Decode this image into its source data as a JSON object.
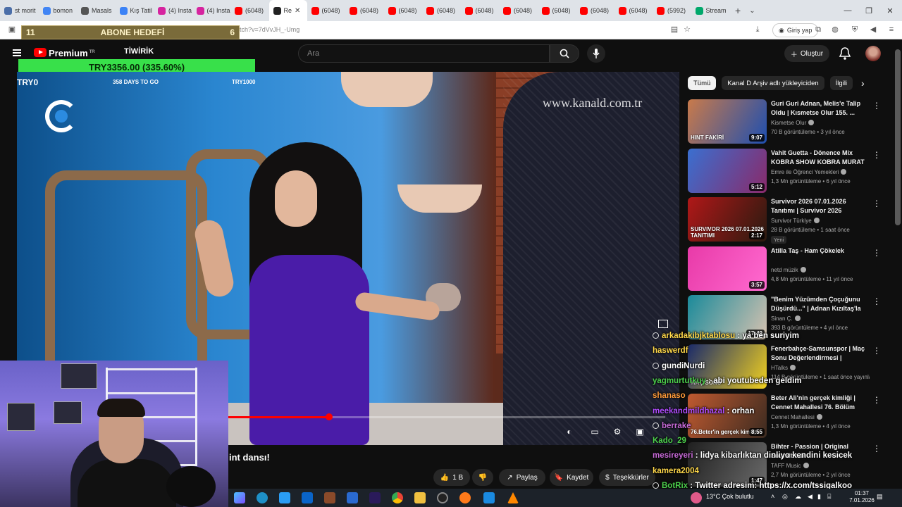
{
  "browser": {
    "tabs": [
      {
        "label": "st morit",
        "color": "#4b6ea8"
      },
      {
        "label": "bomon",
        "color": "#4285f4"
      },
      {
        "label": "Masals",
        "color": "#555555"
      },
      {
        "label": "Kış Tatil",
        "color": "#3b82f6"
      },
      {
        "label": "(4) Insta",
        "color": "#d6249f"
      },
      {
        "label": "(4) Insta",
        "color": "#d6249f"
      },
      {
        "label": "(6048)",
        "color": "#ff0000"
      },
      {
        "label": "Re",
        "color": "#222222",
        "active": true
      },
      {
        "label": "(6048)",
        "color": "#ff0000"
      },
      {
        "label": "(6048)",
        "color": "#ff0000"
      },
      {
        "label": "(6048)",
        "color": "#ff0000"
      },
      {
        "label": "(6048)",
        "color": "#ff0000"
      },
      {
        "label": "(6048)",
        "color": "#ff0000"
      },
      {
        "label": "(6048)",
        "color": "#ff0000"
      },
      {
        "label": "(6048)",
        "color": "#ff0000"
      },
      {
        "label": "(6048)",
        "color": "#ff0000"
      },
      {
        "label": "(6048)",
        "color": "#ff0000"
      },
      {
        "label": "(5992)",
        "color": "#ff0000"
      },
      {
        "label": "Stream",
        "color": "#00a86b"
      }
    ],
    "url_fragment": "tch?v=7dVvJH_-Umg",
    "login_label": "Giriş yap"
  },
  "overlay": {
    "goal_count": "11",
    "goal_label": "ABONE HEDEFİ",
    "goal_target": "6",
    "streamer_name": "TİWİRİK",
    "crypto_value": "TRY3356.00 (335.60%)",
    "try0": "TRY0",
    "days_left": "358 DAYS TO GO",
    "try1000": "TRY1000"
  },
  "youtube": {
    "brand": "Premium",
    "brand_region": "TR",
    "search_placeholder": "Ara",
    "create_label": "Oluştur",
    "video_watermark": "www.kanald.com.tr",
    "video_title": "int dansı!",
    "video_progress": 0.23,
    "actions": {
      "like_count": "1 B",
      "share": "Paylaş",
      "save": "Kaydet",
      "thanks": "Teşekkürler"
    },
    "chips": [
      {
        "label": "Tümü",
        "active": true
      },
      {
        "label": "Kanal D Arşiv adlı yükleyiciden",
        "active": false
      },
      {
        "label": "İlgili",
        "active": false
      }
    ],
    "recommendations": [
      {
        "title": "Guri Guri Adnan, Melis'e Talip Oldu | Kısmetse Olur 155. ...",
        "channel": "Kismetse Olur",
        "meta": "70 B görüntüleme • 3 yıl önce",
        "duration": "9:07",
        "thumb_text": "HINT FAKİRİ",
        "badge": "",
        "c1": "#c97a4a",
        "c2": "#1e4fb0"
      },
      {
        "title": "Vahit Guetta - Dönence Mix KOBRA SHOW KOBRA MURAT",
        "channel": "Emre ile Öğrenci Yemekleri",
        "meta": "1,3 Mn görüntüleme • 6 yıl önce",
        "duration": "5:12",
        "thumb_text": "",
        "badge": "",
        "c1": "#3a6fd0",
        "c2": "#8a2a6a"
      },
      {
        "title": "Survivor 2026 07.01.2026 Tanıtımı | Survivor 2026 Ünlüle...",
        "channel": "Survivor Türkiye",
        "meta": "28 B görüntüleme • 1 saat önce",
        "duration": "2:17",
        "thumb_text": "SURVIVOR 2026 07.01.2026 TANITIMI",
        "badge": "Yeni",
        "c1": "#b01818",
        "c2": "#2a1a10"
      },
      {
        "title": "Atilla Taş - Ham Çökelek",
        "channel": "netd müzik",
        "meta": "4,8 Mn görüntüleme • 11 yıl önce",
        "duration": "3:57",
        "thumb_text": "",
        "badge": "",
        "c1": "#e83aa8",
        "c2": "#ff6ad0"
      },
      {
        "title": "\"Benim Yüzümden Çoçuğunu Düşürdü...\" | Adnan Kızıltaş'la ...",
        "channel": "Sinan Ç.",
        "meta": "393 B görüntüleme • 4 yıl önce",
        "duration": "17:49",
        "thumb_text": "",
        "badge": "",
        "c1": "#1a8a9a",
        "c2": "#d6c2b0"
      },
      {
        "title": "Fenerbahçe-Samsunspor | Maç Sonu Değerlendirmesi | Uwufufu",
        "channel": "HTalks",
        "meta": "114 B görüntüleme • 1 saat önce yayınla...",
        "duration": "",
        "thumb_text": "MAÇ SONU",
        "badge": "",
        "c1": "#1a2a6a",
        "c2": "#f0d020"
      },
      {
        "title": "Beter Ali'nin gerçek kimliği | Cennet Mahallesi 76. Bölüm",
        "channel": "Cennet Mahallesi",
        "meta": "1,3 Mn görüntüleme • 4 yıl önce",
        "duration": "8:55",
        "thumb_text": "76.Beter'in gerçek kimliği",
        "badge": "",
        "c1": "#c05a30",
        "c2": "#3a2a20"
      },
      {
        "title": "Bihter - Passion | Original Soundtrack",
        "channel": "TAFF Music",
        "meta": "2,7 Mn görüntüleme • 2 yıl önce",
        "duration": "1:47",
        "thumb_text": "",
        "badge": "",
        "c1": "#202020",
        "c2": "#6a6a6a"
      }
    ]
  },
  "chat": [
    {
      "user": "arkadakibjktablosu",
      "msg": "ya ben suriyim",
      "color": "#ffd84a",
      "icon": true
    },
    {
      "user": "haswerdf",
      "msg": "",
      "color": "#ffd84a",
      "icon": false
    },
    {
      "user": "gundiNurdi",
      "msg": "",
      "color": "#ffffff",
      "icon": true
    },
    {
      "user": "yagmurtutkuy",
      "msg": "abi youtubeden geldim",
      "color": "#4dd04d",
      "icon": false
    },
    {
      "user": "shanaso",
      "msg": "",
      "color": "#ff9a3a",
      "icon": false
    },
    {
      "user": "meekandmildhazal",
      "msg": "orhan",
      "color": "#b04dff",
      "icon": false
    },
    {
      "user": "berrake",
      "msg": "",
      "color": "#c86ad8",
      "icon": true
    },
    {
      "user": "Kado_29",
      "msg": "",
      "color": "#4dd04d",
      "icon": false
    },
    {
      "user": "mesireyeri",
      "msg": "lidya kibarlıktan dinliyo kendini kesicek",
      "color": "#c86ad8",
      "icon": false
    },
    {
      "user": "kamera2004",
      "msg": "",
      "color": "#ffd84a",
      "icon": false
    },
    {
      "user": "BotRix",
      "msg": "Twitter adresim: https://x.com/tssigalkoo",
      "color": "#4dd04d",
      "icon": true
    }
  ],
  "taskbar": {
    "weather": "13°C  Çok bulutlu",
    "time": "01:37",
    "date": "7.01.2026"
  }
}
